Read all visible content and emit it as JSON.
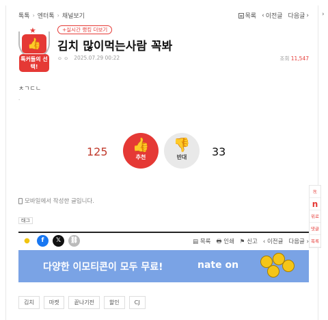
{
  "breadcrumb": {
    "items": [
      "톡톡",
      "엔터톡",
      "채널보기"
    ]
  },
  "topnav": {
    "list": "목록",
    "prev": "이전글",
    "next": "다음글"
  },
  "side_arrow": "›",
  "badge": {
    "text": "톡커들의 선택!"
  },
  "live_ranking": "+실시간 랭킹 더보기",
  "post": {
    "title": "김치 많이먹는사람 꼭봐",
    "author_dots": "ㅇ ㅇ",
    "date": "2025.07.29 00:22",
    "views_label": "조회",
    "views": "11,547",
    "body": "ㅊㄱㄷㄴ",
    "body_extra": ".",
    "mobile_note": "모바일에서 작성한 글입니다."
  },
  "votes": {
    "up_count": "125",
    "up_label": "추천",
    "down_count": "33",
    "down_label": "반대"
  },
  "tag_label": "태그",
  "rail": [
    "위로",
    "댓글",
    "목록"
  ],
  "share": {
    "list": "목록",
    "print": "인쇄",
    "report": "신고",
    "prev": "이전글",
    "next": "다음글"
  },
  "banner": {
    "text": "다양한 이모티콘이 모두 무료!",
    "brand": "nate on"
  },
  "tags": [
    "김치",
    "마켓",
    "끝나기전",
    "할인",
    "CJ"
  ],
  "colors": {
    "accent": "#e53935",
    "banner": "#7aa3e5"
  }
}
